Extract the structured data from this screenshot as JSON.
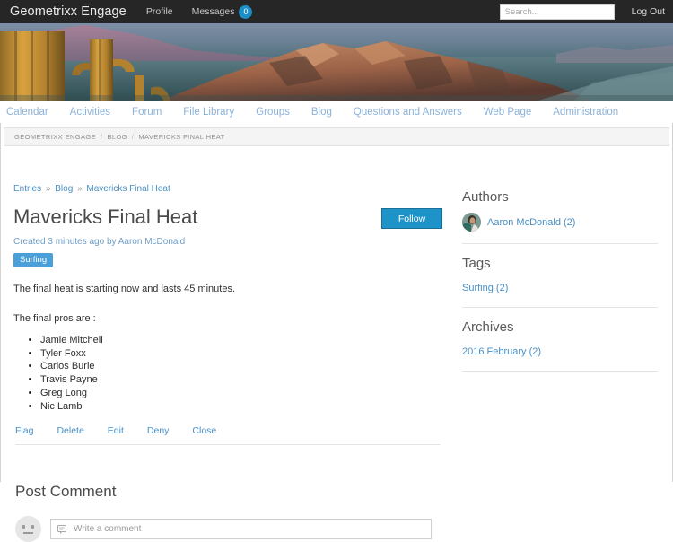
{
  "topbar": {
    "brand": "Geometrixx Engage",
    "nav": [
      {
        "label": "Profile",
        "name": "profile"
      },
      {
        "label": "Messages",
        "name": "messages",
        "badge": "0"
      }
    ],
    "search_placeholder": "Search...",
    "logout_label": "Log Out"
  },
  "mainnav": {
    "items": [
      {
        "label": "Calendar"
      },
      {
        "label": "Activities"
      },
      {
        "label": "Forum"
      },
      {
        "label": "File Library"
      },
      {
        "label": "Groups"
      },
      {
        "label": "Blog"
      },
      {
        "label": "Questions and Answers"
      },
      {
        "label": "Web Page"
      },
      {
        "label": "Administration"
      }
    ]
  },
  "breadcrumb": {
    "root": "GEOMETRIXX ENGAGE",
    "section": "BLOG",
    "current": "MAVERICKS FINAL HEAT",
    "separator": "/"
  },
  "post": {
    "minicrumb": {
      "entries": "Entries",
      "blog": "Blog",
      "current": "Mavericks Final Heat",
      "arrow": "»"
    },
    "title": "Mavericks Final Heat",
    "follow_label": "Follow",
    "meta": "Created 3 minutes ago by Aaron McDonald",
    "tag": "Surfing",
    "paragraph1": "The final heat is starting now and lasts 45 minutes.",
    "paragraph2": "The final pros are :",
    "pros": [
      "Jamie Mitchell",
      "Tyler Foxx",
      "Carlos Burle",
      "Travis Payne",
      "Greg Long",
      "Nic Lamb"
    ],
    "actions": [
      {
        "label": "Flag",
        "name": "flag"
      },
      {
        "label": "Delete",
        "name": "delete"
      },
      {
        "label": "Edit",
        "name": "edit"
      },
      {
        "label": "Deny",
        "name": "deny"
      },
      {
        "label": "Close",
        "name": "close"
      }
    ]
  },
  "comments": {
    "heading": "Post Comment",
    "placeholder": "Write a comment"
  },
  "sidebar": {
    "authors": {
      "heading": "Authors",
      "entry": "Aaron McDonald (2)"
    },
    "tags": {
      "heading": "Tags",
      "entry": "Surfing (2)"
    },
    "archives": {
      "heading": "Archives",
      "entry": "2016 February (2)"
    }
  },
  "colors": {
    "header_bg": "#262626",
    "accent_blue": "#1e93c8",
    "badge_blue": "#4a9fd8",
    "link_blue": "#4a90c4",
    "nav_link": "#8cb3d9"
  }
}
